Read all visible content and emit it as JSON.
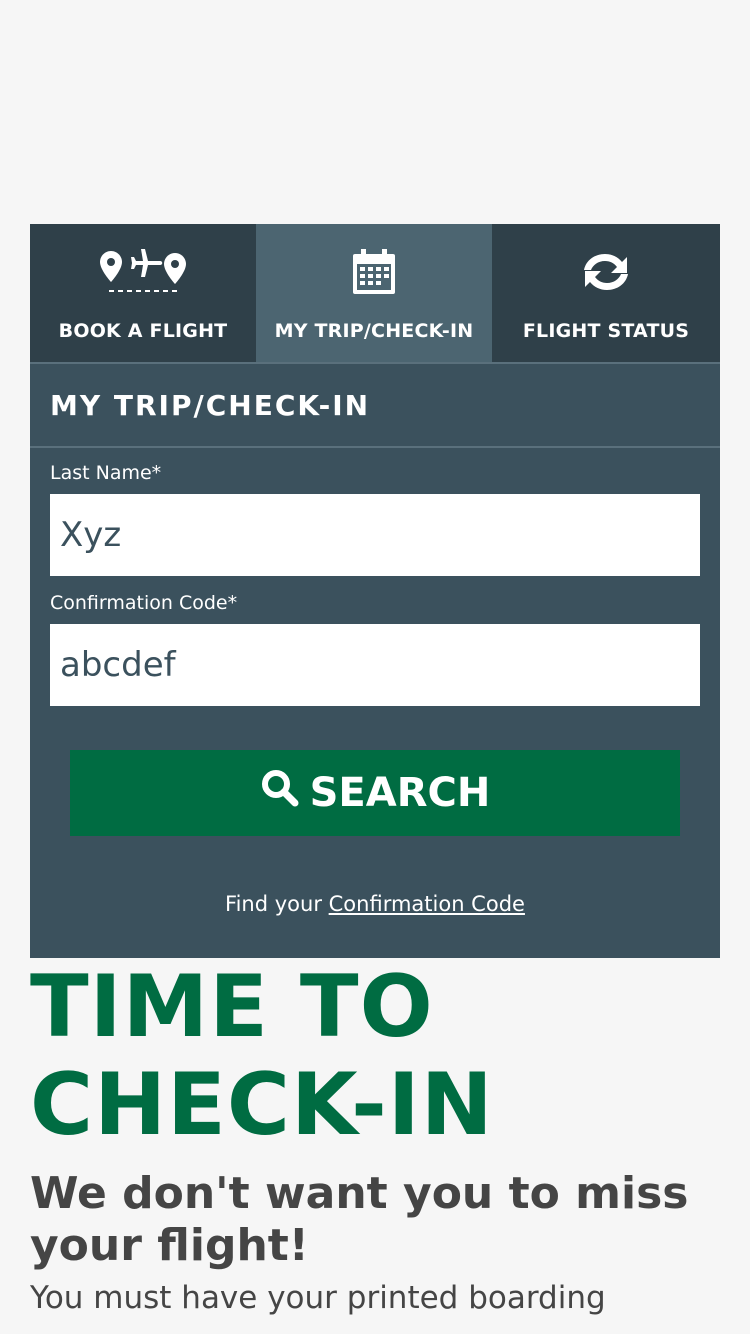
{
  "colors": {
    "brand_green": "#006c42",
    "panel": "#3b515d",
    "tab_bg": "#2f4049",
    "tab_active": "#4c6571",
    "text_dark": "#454545"
  },
  "tabs": [
    {
      "label": "BOOK A FLIGHT",
      "icon": "route-plane-icon",
      "active": false
    },
    {
      "label": "MY TRIP/CHECK-IN",
      "icon": "calendar-icon",
      "active": true
    },
    {
      "label": "FLIGHT STATUS",
      "icon": "refresh-icon",
      "active": false
    }
  ],
  "checkin": {
    "title": "MY TRIP/CHECK-IN",
    "last_name_label": "Last Name*",
    "last_name_value": "Xyz",
    "code_label": "Confirmation Code*",
    "code_value": "abcdef",
    "search_label": "SEARCH",
    "search_icon": "search-icon",
    "find_prefix": "Find your",
    "find_link": "Confirmation Code"
  },
  "content": {
    "title_line1": "TIME TO",
    "title_line2": "CHECK-IN",
    "subhead": "We don't want you to miss your flight!",
    "body": "You must have your printed boarding"
  }
}
